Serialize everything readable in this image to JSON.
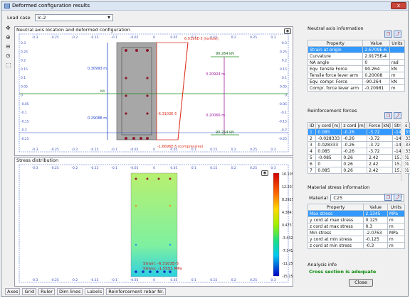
{
  "window": {
    "title": "Deformed configuration results",
    "close": "x"
  },
  "load_case": {
    "label": "Load case",
    "value": "lc-2"
  },
  "toolbar_icons": [
    "move-icon",
    "zoom-in-icon",
    "zoom-out-icon",
    "zoom-fit-icon",
    "select-icon"
  ],
  "top_panel": {
    "title": "Neutral axis location and deformed configuration",
    "x_ticks": [
      "-0.3",
      "-0.25",
      "-0.2",
      "-0.15",
      "-0.1",
      "-0.05",
      "0",
      "0.05",
      "0.1",
      "0.15",
      "0.2",
      "0.25",
      "0.3"
    ],
    "y_ticks": [
      "0.3",
      "0.25",
      "0.2",
      "0.15",
      "0.1",
      "0.05",
      "0",
      "-0.05",
      "-0.1",
      "-0.15",
      "-0.2",
      "-0.25"
    ],
    "dim_top": "0.30993 m",
    "dim_bottom": "0.29088 m",
    "lever_top": "0.20924 m",
    "lever_bottom": "0.20066 m",
    "force_top": "90.264 kN",
    "force_bottom": "90.264 kN",
    "strain_top": "6.0196E-5 (tensile)",
    "strain_mid": "-6.3103E-5",
    "strain_bottom": "-1.6696E-5 (compressive)",
    "na_label": "NA"
  },
  "bottom_panel": {
    "title": "Stress distribution",
    "colorbar": [
      "16.109",
      "12.201",
      "8.2925",
      "4.3841",
      "0.4757",
      "-3.4327",
      "-7.3412",
      "-11.25",
      "-15.158"
    ],
    "tooltip_strain": "Strain: -6.3103E-5",
    "tooltip_stress": "Stress: -1.5551 MPa"
  },
  "tabs": [
    "Axes",
    "Grid",
    "Ruler",
    "Dim lines",
    "Labels",
    "Reinforcement rebar Nr."
  ],
  "na_info": {
    "title": "Neutral axis information",
    "headers": [
      "Property",
      "Value",
      "Units"
    ],
    "rows": [
      [
        "Strain at origin",
        "2.6709E-6",
        ""
      ],
      [
        "Curvature",
        "2.9175E-4",
        ""
      ],
      [
        "NA angle",
        "0",
        "rad"
      ],
      [
        "Eqv. tensile Force",
        "90.264",
        "kN"
      ],
      [
        "Tensile force lever arm",
        "0.20008",
        "m"
      ],
      [
        "Eqv. compr. Force",
        "-90.264",
        "kN"
      ],
      [
        "Compr. force lever arm",
        "-0.20981",
        "m"
      ]
    ]
  },
  "reinf": {
    "title": "Reinforcement forces",
    "headers": [
      "ID",
      "y cord [m]",
      "z cord [m]",
      "Force [kN]",
      "Stress [MPa]"
    ],
    "rows": [
      [
        "1",
        "0.085",
        "-0.26",
        "-3.72",
        "-14.633"
      ],
      [
        "2",
        "-0.028333",
        "-0.26",
        "-3.72",
        "-14.633"
      ],
      [
        "3",
        "0.028333",
        "-0.26",
        "-3.72",
        "-14.633"
      ],
      [
        "4",
        "0.085",
        "-0.26",
        "-3.72",
        "-14.633"
      ],
      [
        "5",
        "-0.085",
        "0.26",
        "2.42",
        "15.701"
      ],
      [
        "6",
        "0",
        "0.26",
        "2.42",
        "15.701"
      ],
      [
        "7",
        "0.085",
        "0.26",
        "2.42",
        "15.701"
      ]
    ]
  },
  "material": {
    "title": "Material stress information",
    "label": "Material",
    "value": "C25",
    "headers": [
      "Property",
      "Value",
      "Units"
    ],
    "rows": [
      [
        "Max stress",
        "2.1345",
        "MPa"
      ],
      [
        "y cord at max stress",
        "0.125",
        "m"
      ],
      [
        "z cord at max stress",
        "0.3",
        "m"
      ],
      [
        "Min stress",
        "-2.0763",
        "MPa"
      ],
      [
        "y cord at min stress",
        "-0.125",
        "m"
      ],
      [
        "z cord at min stress",
        "-0.3",
        "m"
      ]
    ]
  },
  "analysis": {
    "title": "Analysis info",
    "message": "Cross section is adequate"
  },
  "close_button": "Close"
}
